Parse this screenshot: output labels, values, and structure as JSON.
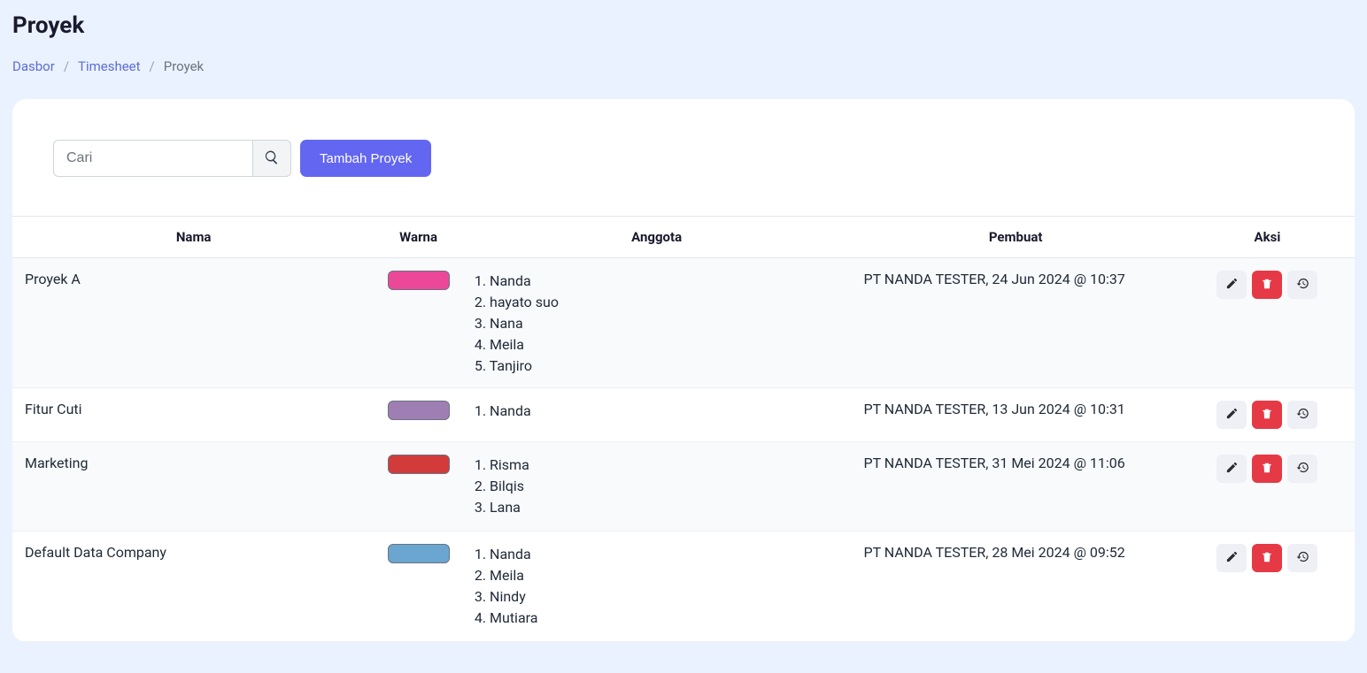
{
  "page": {
    "title": "Proyek"
  },
  "breadcrumb": {
    "items": [
      {
        "label": "Dasbor",
        "link": true
      },
      {
        "label": "Timesheet",
        "link": true
      },
      {
        "label": "Proyek",
        "link": false
      }
    ]
  },
  "toolbar": {
    "search_placeholder": "Cari",
    "add_label": "Tambah Proyek"
  },
  "table": {
    "headers": {
      "nama": "Nama",
      "warna": "Warna",
      "anggota": "Anggota",
      "pembuat": "Pembuat",
      "aksi": "Aksi"
    },
    "rows": [
      {
        "nama": "Proyek A",
        "warna": "#ec4899",
        "anggota": [
          "Nanda",
          "hayato suo",
          "Nana",
          "Meila",
          "Tanjiro"
        ],
        "pembuat": "PT NANDA TESTER, 24 Jun 2024 @ 10:37",
        "scroll": true
      },
      {
        "nama": "Fitur Cuti",
        "warna": "#9f7fb3",
        "anggota": [
          "Nanda"
        ],
        "pembuat": "PT NANDA TESTER, 13 Jun 2024 @ 10:31",
        "scroll": false
      },
      {
        "nama": "Marketing",
        "warna": "#d33a3a",
        "anggota": [
          "Risma",
          "Bilqis",
          "Lana"
        ],
        "pembuat": "PT NANDA TESTER, 31 Mei 2024 @ 11:06",
        "scroll": false
      },
      {
        "nama": "Default Data Company",
        "warna": "#6aa6d0",
        "anggota": [
          "Nanda",
          "Meila",
          "Nindy",
          "Mutiara"
        ],
        "pembuat": "PT NANDA TESTER, 28 Mei 2024 @ 09:52",
        "scroll": false
      }
    ]
  },
  "icons": {
    "edit": "edit-icon",
    "delete": "delete-icon",
    "history": "history-icon",
    "search": "search-icon"
  }
}
